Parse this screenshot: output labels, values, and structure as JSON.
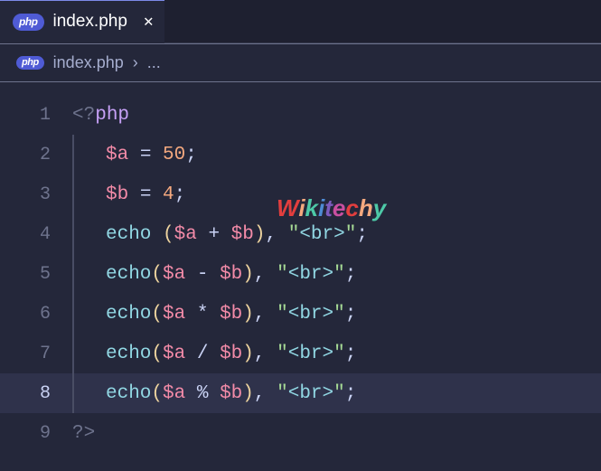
{
  "tab": {
    "icon_text": "php",
    "filename": "index.php",
    "close": "✕"
  },
  "breadcrumb": {
    "icon_text": "php",
    "file": "index.php",
    "sep": "›",
    "dots": "..."
  },
  "lines": {
    "l1": {
      "num": "1"
    },
    "l2": {
      "num": "2",
      "var": "$a",
      "eq": " = ",
      "val": "50",
      "semi": ";"
    },
    "l3": {
      "num": "3",
      "var": "$b",
      "eq": " = ",
      "val": "4",
      "semi": ";"
    },
    "l4": {
      "num": "4",
      "kw": "echo ",
      "lp": "(",
      "a": "$a",
      "op": " + ",
      "b": "$b",
      "rp": ")",
      "comma": ", ",
      "q1": "\"",
      "br": "<br>",
      "q2": "\"",
      "semi": ";"
    },
    "l5": {
      "num": "5",
      "kw": "echo",
      "lp": "(",
      "a": "$a",
      "op": " - ",
      "b": "$b",
      "rp": ")",
      "comma": ", ",
      "q1": "\"",
      "br": "<br>",
      "q2": "\"",
      "semi": ";"
    },
    "l6": {
      "num": "6",
      "kw": "echo",
      "lp": "(",
      "a": "$a",
      "op": " * ",
      "b": "$b",
      "rp": ")",
      "comma": ", ",
      "q1": "\"",
      "br": "<br>",
      "q2": "\"",
      "semi": ";"
    },
    "l7": {
      "num": "7",
      "kw": "echo",
      "lp": "(",
      "a": "$a",
      "op": " / ",
      "b": "$b",
      "rp": ")",
      "comma": ", ",
      "q1": "\"",
      "br": "<br>",
      "q2": "\"",
      "semi": ";"
    },
    "l8": {
      "num": "8",
      "kw": "echo",
      "lp": "(",
      "a": "$a",
      "op": " % ",
      "b": "$b",
      "rp": ")",
      "comma": ", ",
      "q1": "\"",
      "br": "<br>",
      "q2": "\"",
      "semi": ";"
    },
    "l9": {
      "num": "9"
    }
  },
  "watermark": {
    "w": "W",
    "i": "i",
    "k": "k",
    "i2": "i",
    "t": "t",
    "e": "e",
    "c": "c",
    "h": "h",
    "y": "y"
  }
}
